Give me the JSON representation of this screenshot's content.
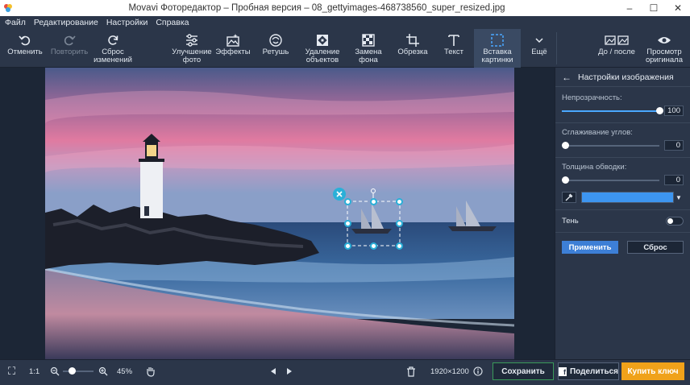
{
  "window": {
    "title": "Movavi Фоторедактор – Пробная версия – 08_gettyimages-468738560_super_resized.jpg",
    "minimize": "–",
    "maximize": "☐",
    "close": "✕"
  },
  "menu": [
    "Файл",
    "Редактирование",
    "Настройки",
    "Справка"
  ],
  "toolbar": {
    "undo": "Отменить",
    "redo": "Повторить",
    "reset": "Сброс\nизменений",
    "enhance": "Улучшение\nфото",
    "effects": "Эффекты",
    "retouch": "Ретушь",
    "remove_objects": "Удаление\nобъектов",
    "replace_bg": "Замена\nфона",
    "crop": "Обрезка",
    "text": "Текст",
    "insert_image": "Вставка\nкартинки",
    "more": "Ещё",
    "before_after": "До / после",
    "view_original": "Просмотр\nоригинала"
  },
  "panel": {
    "title": "Настройки изображения",
    "opacity_label": "Непрозрачность:",
    "opacity_value": "100",
    "opacity_level": 1.0,
    "smoothing_label": "Сглаживание углов:",
    "smoothing_value": "0",
    "smoothing_level": 0.0,
    "stroke_label": "Толщина обводки:",
    "stroke_value": "0",
    "stroke_level": 0.0,
    "stroke_color": "#3d95f0",
    "shadow_label": "Тень",
    "shadow_on": false,
    "apply": "Применить",
    "reset": "Сброс"
  },
  "bottom": {
    "fit": "⛶",
    "one_to_one": "1:1",
    "zoom": "45%",
    "zoom_level": 0.3,
    "dimensions": "1920×1200",
    "save": "Сохранить",
    "share": "Поделиться",
    "buy": "Купить ключ"
  },
  "colors": {
    "accent": "#3d7fd6",
    "buy_button": "#f0a21a",
    "save_border": "#3a9a5a",
    "selection_handle": "#2ab0d8"
  }
}
